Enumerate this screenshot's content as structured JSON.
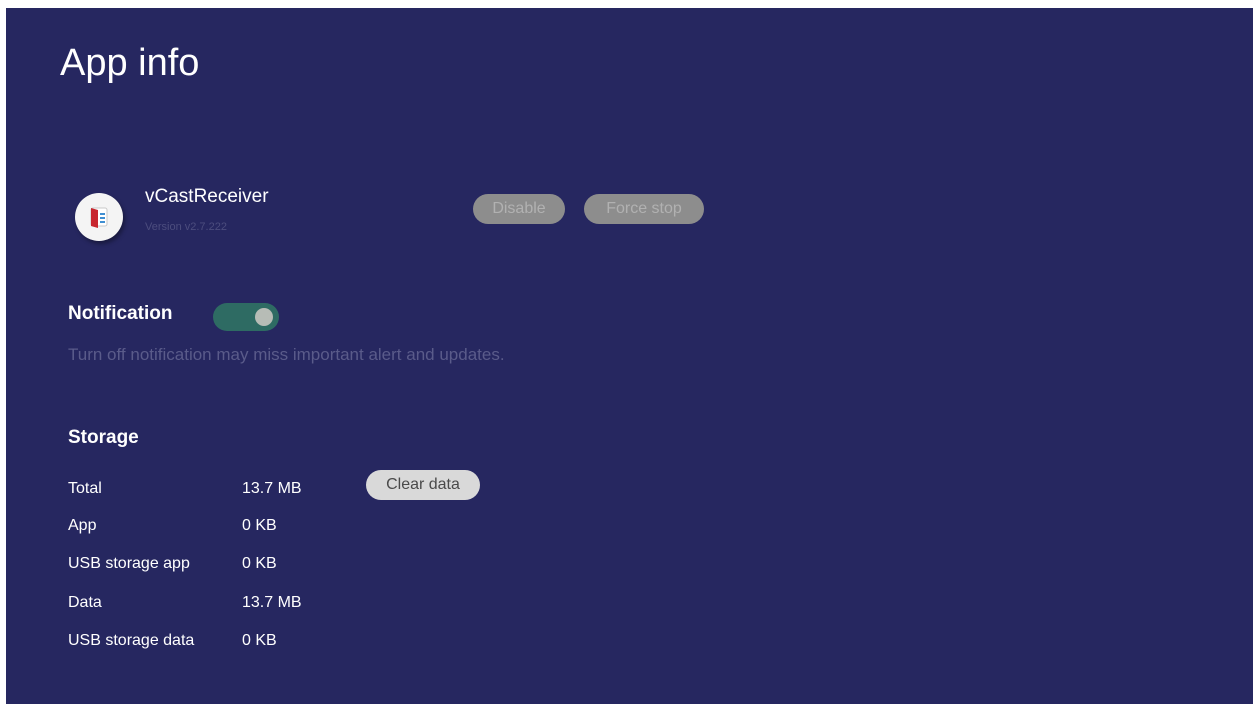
{
  "page": {
    "title": "App info"
  },
  "app": {
    "name": "vCastReceiver",
    "version": "Version v2.7.222",
    "icon": "vcast-receiver-app-icon"
  },
  "actions": {
    "disable_label": "Disable",
    "force_stop_label": "Force stop"
  },
  "notification": {
    "label": "Notification",
    "enabled": true,
    "description": "Turn off notification may miss important alert and updates."
  },
  "storage": {
    "label": "Storage",
    "clear_data_label": "Clear data",
    "rows": [
      {
        "key": "Total",
        "value": "13.7 MB"
      },
      {
        "key": "App",
        "value": "0 KB"
      },
      {
        "key": "USB storage app",
        "value": "0 KB"
      },
      {
        "key": "Data",
        "value": "13.7 MB"
      },
      {
        "key": "USB storage data",
        "value": "0 KB"
      }
    ]
  },
  "colors": {
    "background": "#262760",
    "toggle_on": "#2e6b63"
  }
}
